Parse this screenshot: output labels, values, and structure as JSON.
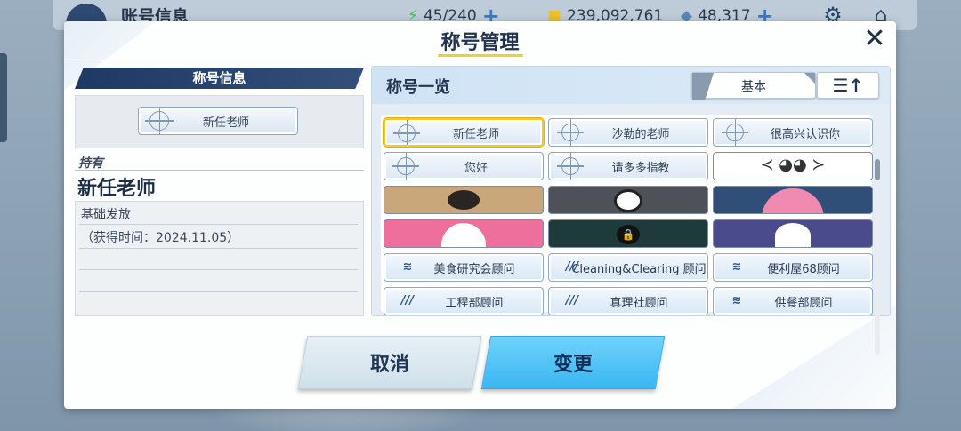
{
  "topbar": {
    "title": "账号信息",
    "ap": "45/240",
    "credits": "239,092,761",
    "gems": "48,317",
    "settings_icon": "gear-icon",
    "home_icon": "home-icon"
  },
  "dialog": {
    "title": "称号管理",
    "close_icon": "close-icon"
  },
  "left": {
    "header": "称号信息",
    "current_badge": "新任老师",
    "owned_label": "持有",
    "owned_name": "新任老师",
    "source": "基础发放",
    "acquired": "（获得时间：2024.11.05）"
  },
  "right": {
    "header": "称号一览",
    "filter_label": "基本",
    "sort_icon": "sort-ascending-icon",
    "titles": [
      {
        "label": "新任老师",
        "kind": "text",
        "selected": true
      },
      {
        "label": "沙勒的老师",
        "kind": "text"
      },
      {
        "label": "很高兴认识你",
        "kind": "text"
      },
      {
        "label": "您好",
        "kind": "text"
      },
      {
        "label": "请多多指教",
        "kind": "text"
      },
      {
        "label": "",
        "kind": "picture",
        "picture": "bird-wings"
      },
      {
        "label": "",
        "kind": "picture",
        "picture": "brown-bear"
      },
      {
        "label": "",
        "kind": "picture",
        "picture": "panda"
      },
      {
        "label": "",
        "kind": "picture",
        "picture": "pink-bird"
      },
      {
        "label": "",
        "kind": "picture",
        "picture": "white-bunny"
      },
      {
        "label": "",
        "kind": "picture",
        "picture": "dark-lock"
      },
      {
        "label": "",
        "kind": "picture",
        "picture": "purple-cat"
      },
      {
        "label": "美食研究会顾问",
        "kind": "club",
        "emblem": "wing"
      },
      {
        "label": "Cleaning&Clearing 顾问",
        "kind": "club",
        "emblem": "TTI"
      },
      {
        "label": "便利屋68顾问",
        "kind": "club",
        "emblem": "wing"
      },
      {
        "label": "工程部顾问",
        "kind": "club",
        "emblem": "TTI"
      },
      {
        "label": "真理社顾问",
        "kind": "club",
        "emblem": "TTI"
      },
      {
        "label": "供餐部顾问",
        "kind": "club",
        "emblem": "wing"
      }
    ]
  },
  "buttons": {
    "cancel": "取消",
    "confirm": "变更"
  },
  "colors": {
    "accent_yellow": "#f3c928",
    "confirm_blue": "#39b6f2",
    "navy": "#1e3a64"
  }
}
